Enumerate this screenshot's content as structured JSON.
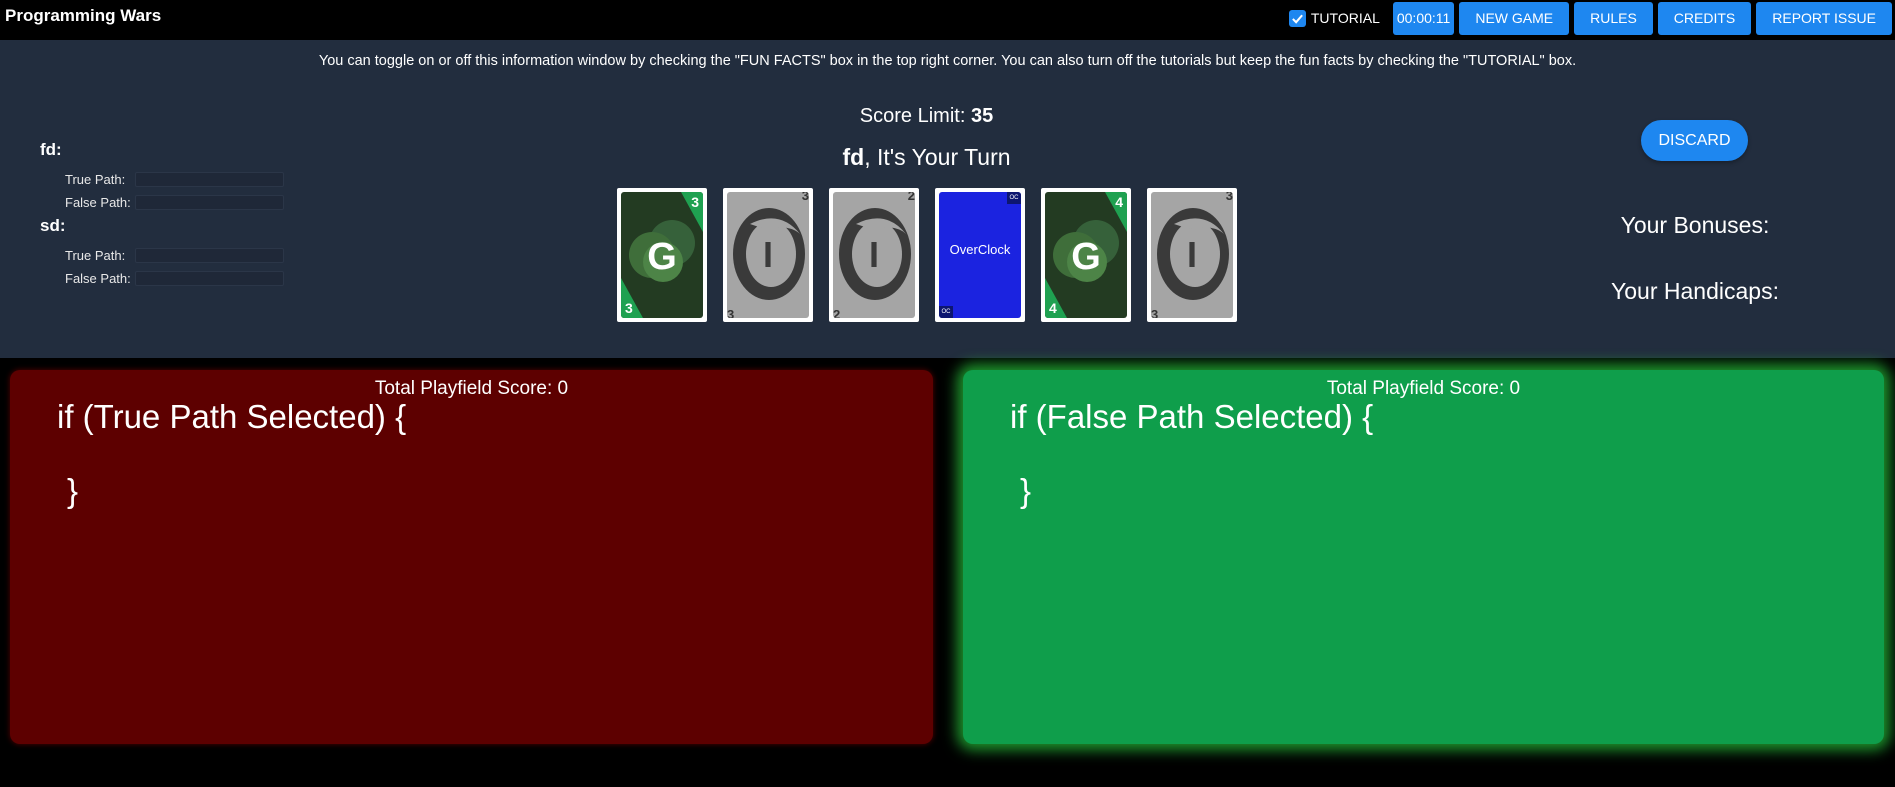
{
  "app_title": "Programming Wars",
  "toolbar": {
    "tutorial_label": "TUTORIAL",
    "tutorial_checked": true,
    "timer": "00:00:11",
    "new_game": "NEW GAME",
    "rules": "RULES",
    "credits": "CREDITS",
    "report_issue": "REPORT ISSUE"
  },
  "info_text": "You can toggle on or off this information window by checking the \"FUN FACTS\" box in the top right corner. You can also turn off the tutorials but keep the fun facts by checking the \"TUTORIAL\" box.",
  "players": [
    {
      "name": "fd:",
      "true_label": "True Path:",
      "false_label": "False Path:"
    },
    {
      "name": "sd:",
      "true_label": "True Path:",
      "false_label": "False Path:"
    }
  ],
  "score_limit": {
    "label": "Score Limit: ",
    "value": "35"
  },
  "turn": {
    "player": "fd",
    "suffix": ", It's Your Turn"
  },
  "hand": [
    {
      "type": "green",
      "letter": "G",
      "value": "3"
    },
    {
      "type": "gray",
      "letter": "I",
      "value": "3"
    },
    {
      "type": "gray",
      "letter": "I",
      "value": "2"
    },
    {
      "type": "blue",
      "label": "OverClock",
      "badge": "OC"
    },
    {
      "type": "green",
      "letter": "G",
      "value": "4"
    },
    {
      "type": "gray",
      "letter": "I",
      "value": "3"
    }
  ],
  "discard_label": "DISCARD",
  "bonuses_label": "Your Bonuses:",
  "handicaps_label": "Your Handicaps:",
  "fields": {
    "true": {
      "score": "Total Playfield Score: 0",
      "code": "if (True Path Selected) {",
      "close": "}"
    },
    "false": {
      "score": "Total Playfield Score: 0",
      "code": "if (False Path Selected) {",
      "close": "}"
    }
  },
  "colors": {
    "accent": "#1e87f0",
    "panel": "#222d3e",
    "true_field": "#5d0000",
    "false_field": "#0f9e4b",
    "green_card_corner": "#1fa151",
    "overclock_card": "#1b23e0"
  }
}
